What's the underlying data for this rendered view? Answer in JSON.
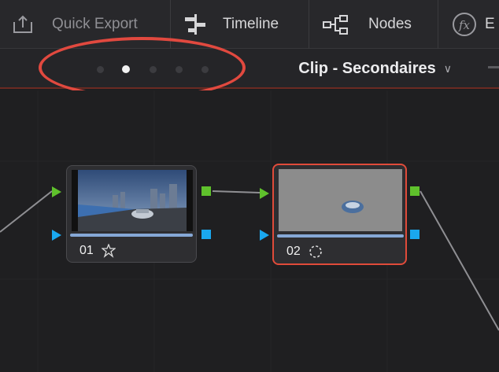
{
  "toolbar": {
    "quick_export_label": "Quick Export",
    "timeline_label": "Timeline",
    "nodes_label": "Nodes",
    "fx_partial": "E"
  },
  "subbar": {
    "page_dots": 5,
    "active_dot": 2,
    "clip_title": "Clip - Secondaires",
    "chevron": "∨"
  },
  "nodes": [
    {
      "id": "01",
      "label": "01"
    },
    {
      "id": "02",
      "label": "02"
    }
  ],
  "colors": {
    "accent_red": "#e04b3a",
    "rgb_port": "#5fc12c",
    "alpha_port": "#1aa8ef"
  }
}
